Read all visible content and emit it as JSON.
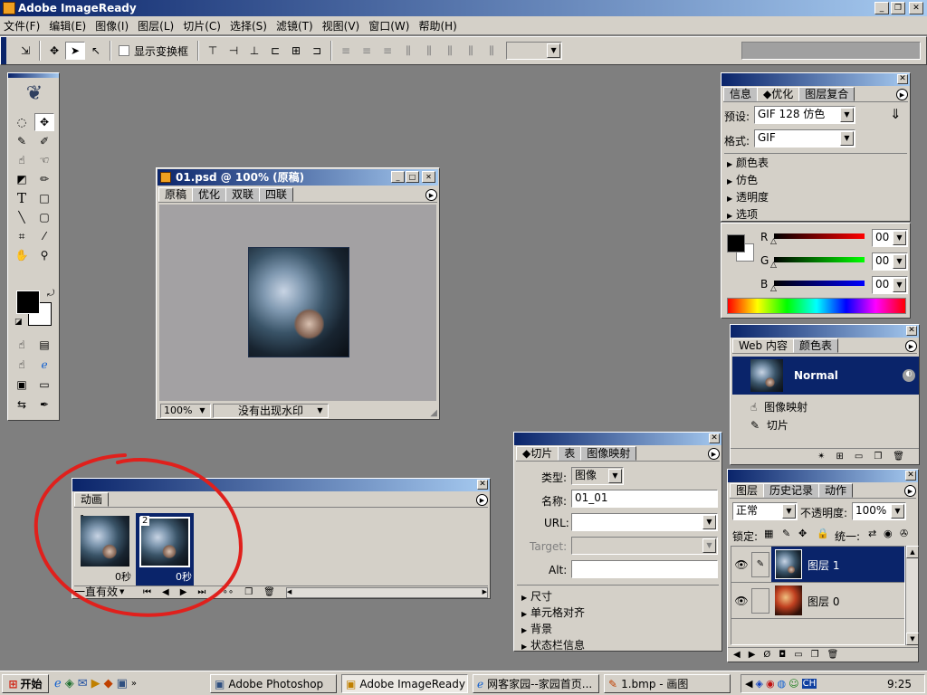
{
  "app": {
    "title": "Adobe ImageReady"
  },
  "menu": [
    "文件(F)",
    "编辑(E)",
    "图像(I)",
    "图层(L)",
    "切片(C)",
    "选择(S)",
    "滤镜(T)",
    "视图(V)",
    "窗口(W)",
    "帮助(H)"
  ],
  "options_bar": {
    "show_transform_label": "显示变换框"
  },
  "doc": {
    "title": "01.psd @ 100% (原稿)",
    "tabs": [
      "原稿",
      "优化",
      "双联",
      "四联"
    ],
    "zoom": "100%",
    "status": "没有出现水印"
  },
  "optimize_panel": {
    "tabs": [
      "信息",
      "优化",
      "图层复合"
    ],
    "preset_label": "预设:",
    "preset_value": "GIF 128 仿色",
    "format_label": "格式:",
    "format_value": "GIF",
    "sections": [
      "颜色表",
      "仿色",
      "透明度",
      "选项"
    ]
  },
  "color_panel": {
    "r_label": "R",
    "g_label": "G",
    "b_label": "B",
    "r_value": "00",
    "g_value": "00",
    "b_value": "00"
  },
  "web_panel": {
    "tabs": [
      "Web 内容",
      "颜色表"
    ],
    "rows": [
      {
        "label": "Normal"
      },
      {
        "label": "图像映射"
      },
      {
        "label": "切片"
      }
    ]
  },
  "slice_panel": {
    "tabs": [
      "切片",
      "表",
      "图像映射"
    ],
    "type_label": "类型:",
    "type_value": "图像",
    "name_label": "名称:",
    "name_value": "01_01",
    "url_label": "URL:",
    "url_value": "",
    "target_label": "Target:",
    "target_value": "",
    "alt_label": "Alt:",
    "alt_value": "",
    "sections": [
      "尺寸",
      "单元格对齐",
      "背景",
      "状态栏信息"
    ]
  },
  "layers_panel": {
    "tabs": [
      "图层",
      "历史记录",
      "动作"
    ],
    "blend_mode": "正常",
    "opacity_label": "不透明度:",
    "opacity_value": "100%",
    "lock_label": "锁定:",
    "unify_label": "统一:",
    "layers": [
      {
        "name": "图层 1",
        "selected": true
      },
      {
        "name": "图层 0",
        "selected": false
      }
    ]
  },
  "animation_panel": {
    "tab": "动画",
    "frames": [
      {
        "num": "1",
        "delay": "0秒"
      },
      {
        "num": "2",
        "delay": "0秒"
      }
    ],
    "loop": "一直有效"
  },
  "taskbar": {
    "start": "开始",
    "tasks": [
      "Adobe Photoshop",
      "Adobe ImageReady",
      "网客家园--家园首页...",
      "1.bmp - 画图"
    ],
    "clock": "9:25",
    "ime": "CH"
  },
  "colors": {
    "title_blue": "#0a246a",
    "title_light": "#a6caf0",
    "face": "#d4d0c8",
    "desktop": "#7f7f7f",
    "annotation_red": "#e0201c"
  }
}
